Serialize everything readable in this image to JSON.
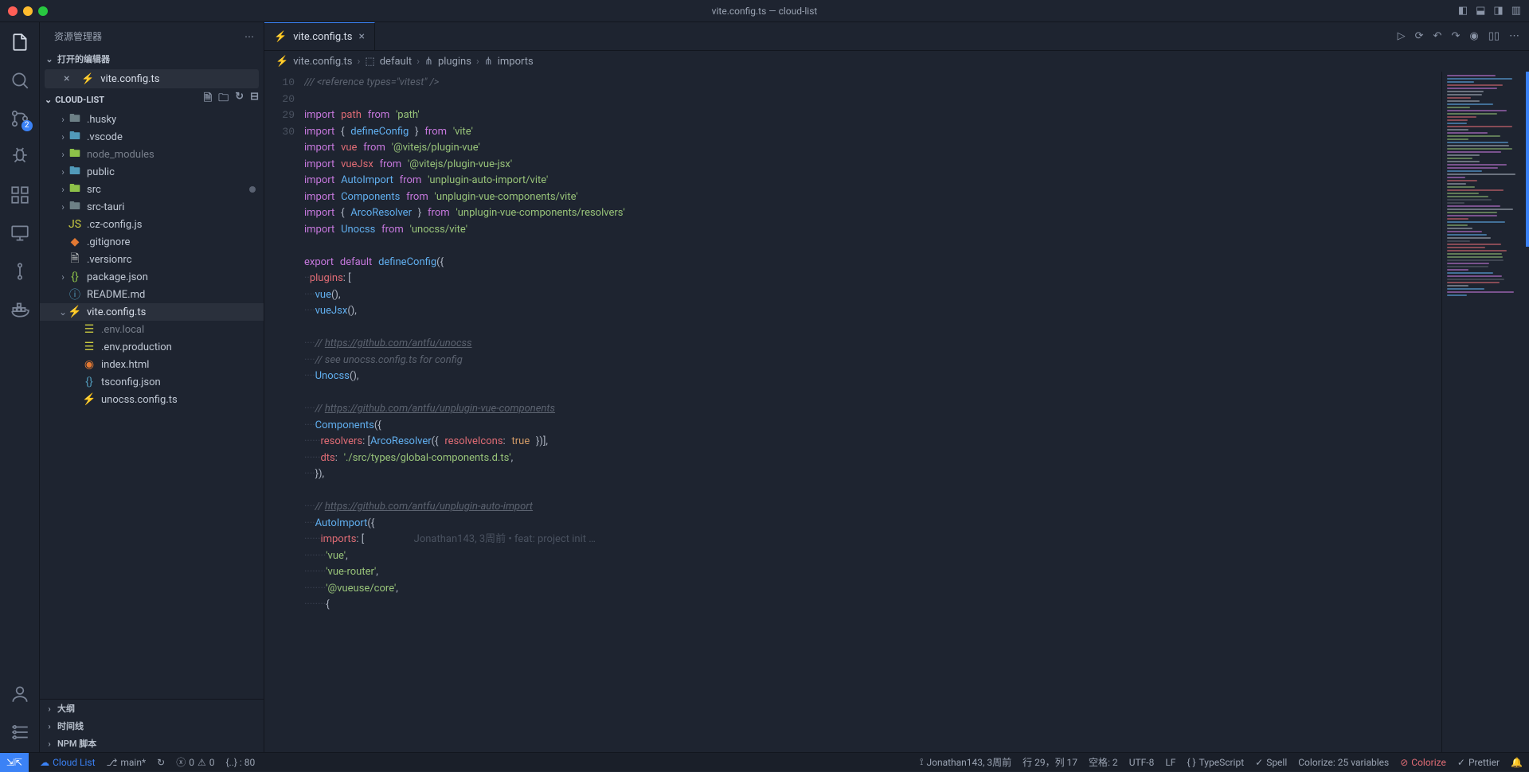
{
  "title": "vite.config.ts — cloud-list",
  "sidebar": {
    "title": "资源管理器",
    "openEditorsLabel": "打开的编辑器",
    "openFile": "vite.config.ts",
    "projectName": "CLOUD-LIST",
    "tree": [
      {
        "type": "folder",
        "name": ".husky",
        "indent": 1,
        "chev": "›",
        "cls": "fc-gray"
      },
      {
        "type": "folder",
        "name": ".vscode",
        "indent": 1,
        "chev": "›",
        "cls": "fc-blue"
      },
      {
        "type": "folder",
        "name": "node_modules",
        "indent": 1,
        "chev": "›",
        "cls": "fc-green",
        "dim": true
      },
      {
        "type": "folder",
        "name": "public",
        "indent": 1,
        "chev": "›",
        "cls": "fc-blue"
      },
      {
        "type": "folder",
        "name": "src",
        "indent": 1,
        "chev": "›",
        "cls": "fc-green",
        "dot": true
      },
      {
        "type": "folder",
        "name": "src-tauri",
        "indent": 1,
        "chev": "›",
        "cls": "fc-gray"
      },
      {
        "type": "file",
        "name": ".cz-config.js",
        "indent": 1,
        "cls": "fc-js"
      },
      {
        "type": "file",
        "name": ".gitignore",
        "indent": 1,
        "cls": "fc-orange"
      },
      {
        "type": "file",
        "name": ".versionrc",
        "indent": 1,
        "cls": "fc-white"
      },
      {
        "type": "file",
        "name": "package.json",
        "indent": 1,
        "chev": "›",
        "cls": "fc-green"
      },
      {
        "type": "file",
        "name": "README.md",
        "indent": 1,
        "cls": "fc-blue"
      },
      {
        "type": "file",
        "name": "vite.config.ts",
        "indent": 1,
        "chev": "⌄",
        "cls": "fc-yellow",
        "sel": true
      },
      {
        "type": "file",
        "name": ".env.local",
        "indent": 2,
        "cls": "fc-yellow",
        "dim": true
      },
      {
        "type": "file",
        "name": ".env.production",
        "indent": 2,
        "cls": "fc-yellow"
      },
      {
        "type": "file",
        "name": "index.html",
        "indent": 2,
        "cls": "fc-orange"
      },
      {
        "type": "file",
        "name": "tsconfig.json",
        "indent": 2,
        "cls": "fc-blue"
      },
      {
        "type": "file",
        "name": "unocss.config.ts",
        "indent": 2,
        "cls": "fc-ts"
      }
    ],
    "bottomPanels": [
      "大纲",
      "时间线",
      "NPM 脚本"
    ]
  },
  "tabs": {
    "active": "vite.config.ts"
  },
  "breadcrumb": [
    "vite.config.ts",
    "default",
    "plugins",
    "imports"
  ],
  "gutter": {
    "show": [
      10,
      20,
      29,
      30
    ]
  },
  "lineCount": 33,
  "inlineBlame": "Jonathan143, 3周前 • feat: project init …",
  "status": {
    "remote": "⎇",
    "cloud": "Cloud List",
    "branch": "main*",
    "sync": "↻",
    "errors": "0",
    "warnings": "0",
    "bracket": "{..} : 80",
    "author": "Jonathan143, 3周前",
    "pos": "行 29，列 17",
    "spaces": "空格: 2",
    "enc": "UTF-8",
    "eol": "LF",
    "lang": "TypeScript",
    "spell": "Spell",
    "colorize": "Colorize: 25 variables",
    "colorize2": "Colorize",
    "prettier": "Prettier"
  }
}
